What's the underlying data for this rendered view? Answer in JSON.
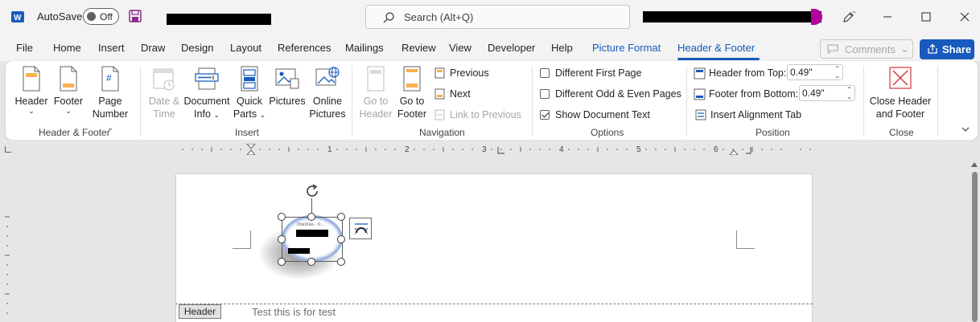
{
  "titlebar": {
    "autosave_label": "AutoSave",
    "autosave_state": "Off",
    "search_placeholder": "Search (Alt+Q)"
  },
  "tabs": [
    "File",
    "Home",
    "Insert",
    "Draw",
    "Design",
    "Layout",
    "References",
    "Mailings",
    "Review",
    "View",
    "Developer",
    "Help",
    "Picture Format",
    "Header & Footer"
  ],
  "active_tab": "Header & Footer",
  "comments_label": "Comments",
  "share_label": "Share",
  "ribbon": {
    "header_footer": {
      "header": "Header",
      "footer": "Footer",
      "page_number_1": "Page",
      "page_number_2": "Number",
      "group": "Header & Footer"
    },
    "insert": {
      "date_time_1": "Date &",
      "date_time_2": "Time",
      "document_info_1": "Document",
      "document_info_2": "Info",
      "quick_parts_1": "Quick",
      "quick_parts_2": "Parts",
      "pictures": "Pictures",
      "online_pictures_1": "Online",
      "online_pictures_2": "Pictures",
      "group": "Insert"
    },
    "navigation": {
      "go_to_header_1": "Go to",
      "go_to_header_2": "Header",
      "go_to_footer_1": "Go to",
      "go_to_footer_2": "Footer",
      "previous": "Previous",
      "next": "Next",
      "link_to_previous": "Link to Previous",
      "group": "Navigation"
    },
    "options": {
      "different_first_page": "Different First Page",
      "different_odd_even": "Different Odd & Even Pages",
      "show_document_text": "Show Document Text",
      "different_first_page_checked": false,
      "different_odd_even_checked": false,
      "show_document_text_checked": true,
      "group": "Options"
    },
    "position": {
      "header_from_top_label": "Header from Top:",
      "header_from_top_value": "0.49\"",
      "footer_from_bottom_label": "Footer from Bottom:",
      "footer_from_bottom_value": "0.49\"",
      "insert_alignment_tab": "Insert Alignment Tab",
      "group": "Position"
    },
    "close": {
      "close_1": "Close Header",
      "close_2": "and Footer",
      "group": "Close"
    }
  },
  "ruler": {
    "numbers": [
      "1",
      "2",
      "3",
      "4",
      "5",
      "6"
    ]
  },
  "document": {
    "header_tag": "Header",
    "header_text": "Test this is for test",
    "image_caption": "OneDrive - O..."
  },
  "colors": {
    "accent": "#185abd",
    "titlebar_bg": "#f3f3f3",
    "canvas_bg": "#e6e6e6"
  }
}
